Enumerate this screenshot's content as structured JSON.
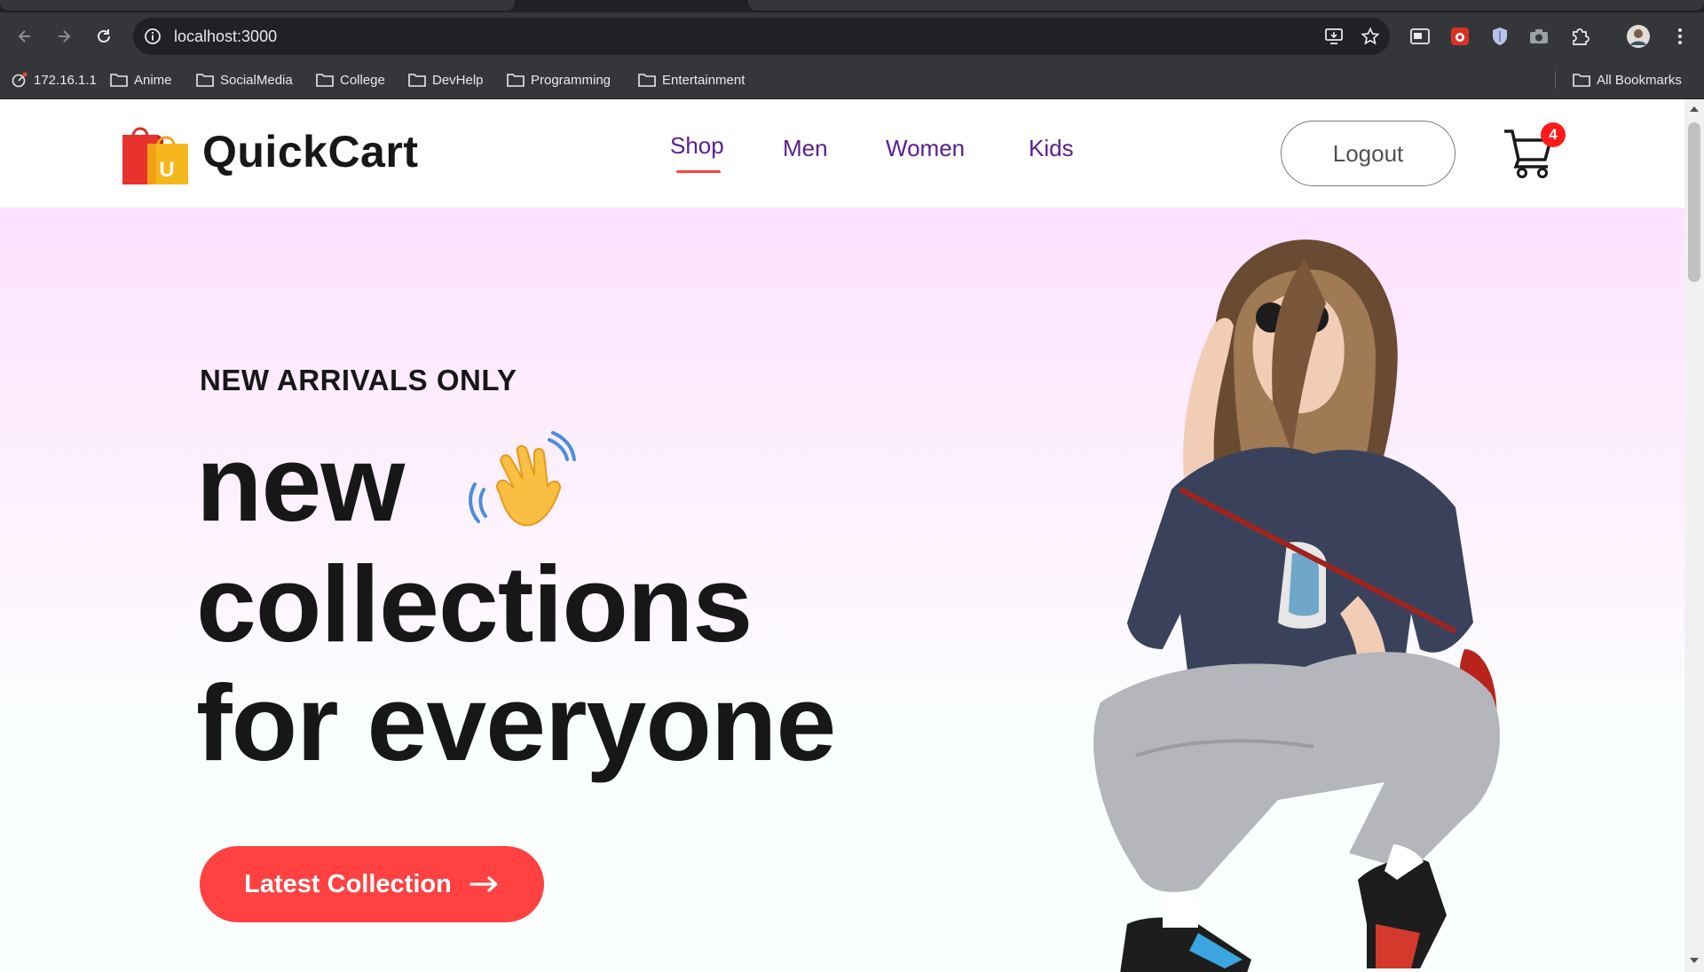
{
  "browser": {
    "url": "localhost:3000",
    "bookmarks": [
      "172.16.1.1",
      "Anime",
      "SocialMedia",
      "College",
      "DevHelp",
      "Programming",
      "Entertainment"
    ],
    "all_bookmarks": "All Bookmarks"
  },
  "navbar": {
    "brand": "QuickCart",
    "logo_letter": "U",
    "menu": [
      "Shop",
      "Men",
      "Women",
      "Kids"
    ],
    "active_menu": "Shop",
    "logout_label": "Logout",
    "cart_count": "4"
  },
  "hero": {
    "eyebrow": "NEW ARRIVALS ONLY",
    "line1": "new",
    "line2": "collections",
    "line3": "for everyone",
    "cta_label": "Latest Collection"
  },
  "colors": {
    "accent": "#ff4141",
    "menu": "#5a1e8e",
    "hero_top": "#fde1ff"
  }
}
